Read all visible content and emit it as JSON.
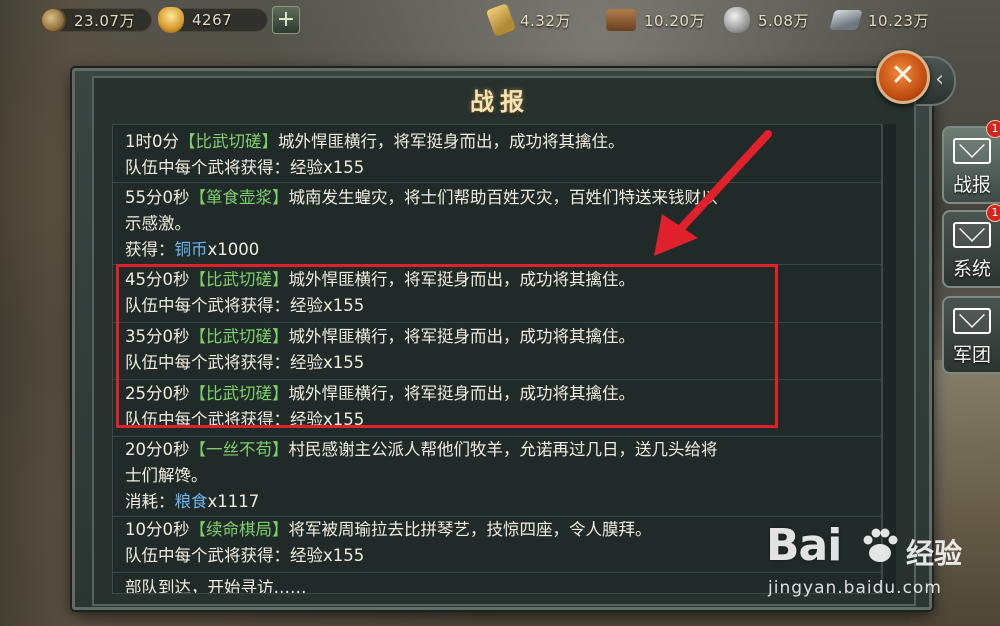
{
  "resources": {
    "copper": "23.07万",
    "gold": "4267",
    "plus": "+",
    "grain": "4.32万",
    "wood": "10.20万",
    "stone": "5.08万",
    "iron": "10.23万"
  },
  "panel": {
    "title": "战报",
    "close": "✕",
    "back": "‹"
  },
  "entries": [
    {
      "time": "1时0分",
      "tag": "【比武切磋】",
      "text": "城外悍匪横行，将军挺身而出，成功将其擒住。",
      "line2_prefix": "队伍中每个武将获得：",
      "line2_item": "经验",
      "line2_count": "x155"
    },
    {
      "time": "55分0秒",
      "tag": "【箪食壶浆】",
      "text": "城南发生蝗灾，将士们帮助百姓灭灾，百姓们特送来钱财以",
      "text2": "示感激。",
      "line2_prefix": "获得：",
      "line2_item": "铜币",
      "line2_count": "x1000"
    },
    {
      "time": "45分0秒",
      "tag": "【比武切磋】",
      "text": "城外悍匪横行，将军挺身而出，成功将其擒住。",
      "line2_prefix": "队伍中每个武将获得：",
      "line2_item": "经验",
      "line2_count": "x155"
    },
    {
      "time": "35分0秒",
      "tag": "【比武切磋】",
      "text": "城外悍匪横行，将军挺身而出，成功将其擒住。",
      "line2_prefix": "队伍中每个武将获得：",
      "line2_item": "经验",
      "line2_count": "x155"
    },
    {
      "time": "25分0秒",
      "tag": "【比武切磋】",
      "text": "城外悍匪横行，将军挺身而出，成功将其擒住。",
      "line2_prefix": "队伍中每个武将获得：",
      "line2_item": "经验",
      "line2_count": "x155"
    },
    {
      "time": "20分0秒",
      "tag": "【一丝不苟】",
      "text": "村民感谢主公派人帮他们牧羊，允诺再过几日，送几头给将",
      "text2": "士们解馋。",
      "line2_prefix": "消耗：",
      "line2_item": "粮食",
      "line2_count": "x1117"
    },
    {
      "time": "10分0秒",
      "tag": "【续命棋局】",
      "text": "将军被周瑜拉去比拼琴艺，技惊四座，令人膜拜。",
      "line2_prefix": "队伍中每个武将获得：",
      "line2_item": "经验",
      "line2_count": "x155"
    },
    {
      "time": "",
      "tag": "",
      "text": "部队到达，开始寻访……"
    }
  ],
  "side_tabs": [
    {
      "label": "战报",
      "badge": "1"
    },
    {
      "label": "系统",
      "badge": "1"
    },
    {
      "label": "军团"
    }
  ],
  "watermark": {
    "logo": "Bai",
    "suffix": "经验",
    "url": "jingyan.baidu.com"
  },
  "colors": {
    "tag": "#7fd06a",
    "item": "#6ab6ee",
    "highlight": "#e0202a",
    "title": "#f6e4b6"
  }
}
